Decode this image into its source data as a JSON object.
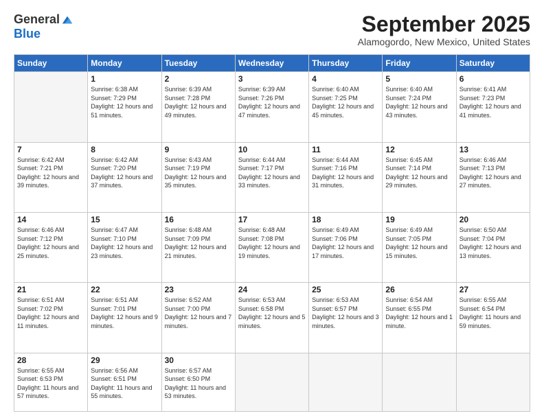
{
  "logo": {
    "general": "General",
    "blue": "Blue"
  },
  "title": "September 2025",
  "location": "Alamogordo, New Mexico, United States",
  "weekdays": [
    "Sunday",
    "Monday",
    "Tuesday",
    "Wednesday",
    "Thursday",
    "Friday",
    "Saturday"
  ],
  "weeks": [
    [
      {
        "day": "",
        "sunrise": "",
        "sunset": "",
        "daylight": ""
      },
      {
        "day": "1",
        "sunrise": "6:38 AM",
        "sunset": "7:29 PM",
        "daylight": "12 hours and 51 minutes."
      },
      {
        "day": "2",
        "sunrise": "6:39 AM",
        "sunset": "7:28 PM",
        "daylight": "12 hours and 49 minutes."
      },
      {
        "day": "3",
        "sunrise": "6:39 AM",
        "sunset": "7:26 PM",
        "daylight": "12 hours and 47 minutes."
      },
      {
        "day": "4",
        "sunrise": "6:40 AM",
        "sunset": "7:25 PM",
        "daylight": "12 hours and 45 minutes."
      },
      {
        "day": "5",
        "sunrise": "6:40 AM",
        "sunset": "7:24 PM",
        "daylight": "12 hours and 43 minutes."
      },
      {
        "day": "6",
        "sunrise": "6:41 AM",
        "sunset": "7:23 PM",
        "daylight": "12 hours and 41 minutes."
      }
    ],
    [
      {
        "day": "7",
        "sunrise": "6:42 AM",
        "sunset": "7:21 PM",
        "daylight": "12 hours and 39 minutes."
      },
      {
        "day": "8",
        "sunrise": "6:42 AM",
        "sunset": "7:20 PM",
        "daylight": "12 hours and 37 minutes."
      },
      {
        "day": "9",
        "sunrise": "6:43 AM",
        "sunset": "7:19 PM",
        "daylight": "12 hours and 35 minutes."
      },
      {
        "day": "10",
        "sunrise": "6:44 AM",
        "sunset": "7:17 PM",
        "daylight": "12 hours and 33 minutes."
      },
      {
        "day": "11",
        "sunrise": "6:44 AM",
        "sunset": "7:16 PM",
        "daylight": "12 hours and 31 minutes."
      },
      {
        "day": "12",
        "sunrise": "6:45 AM",
        "sunset": "7:14 PM",
        "daylight": "12 hours and 29 minutes."
      },
      {
        "day": "13",
        "sunrise": "6:46 AM",
        "sunset": "7:13 PM",
        "daylight": "12 hours and 27 minutes."
      }
    ],
    [
      {
        "day": "14",
        "sunrise": "6:46 AM",
        "sunset": "7:12 PM",
        "daylight": "12 hours and 25 minutes."
      },
      {
        "day": "15",
        "sunrise": "6:47 AM",
        "sunset": "7:10 PM",
        "daylight": "12 hours and 23 minutes."
      },
      {
        "day": "16",
        "sunrise": "6:48 AM",
        "sunset": "7:09 PM",
        "daylight": "12 hours and 21 minutes."
      },
      {
        "day": "17",
        "sunrise": "6:48 AM",
        "sunset": "7:08 PM",
        "daylight": "12 hours and 19 minutes."
      },
      {
        "day": "18",
        "sunrise": "6:49 AM",
        "sunset": "7:06 PM",
        "daylight": "12 hours and 17 minutes."
      },
      {
        "day": "19",
        "sunrise": "6:49 AM",
        "sunset": "7:05 PM",
        "daylight": "12 hours and 15 minutes."
      },
      {
        "day": "20",
        "sunrise": "6:50 AM",
        "sunset": "7:04 PM",
        "daylight": "12 hours and 13 minutes."
      }
    ],
    [
      {
        "day": "21",
        "sunrise": "6:51 AM",
        "sunset": "7:02 PM",
        "daylight": "12 hours and 11 minutes."
      },
      {
        "day": "22",
        "sunrise": "6:51 AM",
        "sunset": "7:01 PM",
        "daylight": "12 hours and 9 minutes."
      },
      {
        "day": "23",
        "sunrise": "6:52 AM",
        "sunset": "7:00 PM",
        "daylight": "12 hours and 7 minutes."
      },
      {
        "day": "24",
        "sunrise": "6:53 AM",
        "sunset": "6:58 PM",
        "daylight": "12 hours and 5 minutes."
      },
      {
        "day": "25",
        "sunrise": "6:53 AM",
        "sunset": "6:57 PM",
        "daylight": "12 hours and 3 minutes."
      },
      {
        "day": "26",
        "sunrise": "6:54 AM",
        "sunset": "6:55 PM",
        "daylight": "12 hours and 1 minute."
      },
      {
        "day": "27",
        "sunrise": "6:55 AM",
        "sunset": "6:54 PM",
        "daylight": "11 hours and 59 minutes."
      }
    ],
    [
      {
        "day": "28",
        "sunrise": "6:55 AM",
        "sunset": "6:53 PM",
        "daylight": "11 hours and 57 minutes."
      },
      {
        "day": "29",
        "sunrise": "6:56 AM",
        "sunset": "6:51 PM",
        "daylight": "11 hours and 55 minutes."
      },
      {
        "day": "30",
        "sunrise": "6:57 AM",
        "sunset": "6:50 PM",
        "daylight": "11 hours and 53 minutes."
      },
      {
        "day": "",
        "sunrise": "",
        "sunset": "",
        "daylight": ""
      },
      {
        "day": "",
        "sunrise": "",
        "sunset": "",
        "daylight": ""
      },
      {
        "day": "",
        "sunrise": "",
        "sunset": "",
        "daylight": ""
      },
      {
        "day": "",
        "sunrise": "",
        "sunset": "",
        "daylight": ""
      }
    ]
  ]
}
